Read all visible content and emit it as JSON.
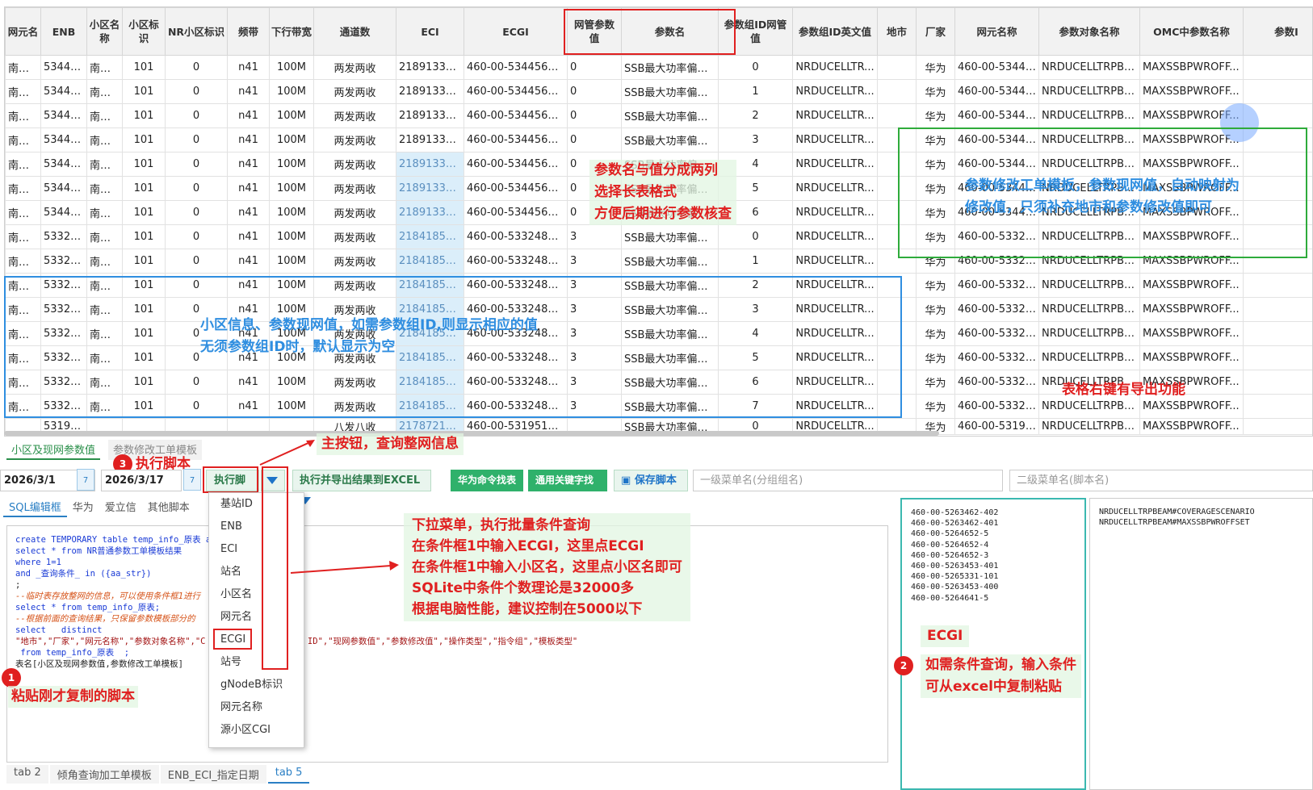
{
  "grid": {
    "columns": [
      "网元名",
      "ENB",
      "小区名称",
      "小区标识",
      "NR小区标识",
      "频带",
      "下行带宽",
      "通道数",
      "ECI",
      "ECGI",
      "网管参数值",
      "参数名",
      "参数组ID网管值",
      "参数组ID英文值",
      "地市",
      "厂家",
      "网元名称",
      "参数对象名称",
      "OMC中参数名称",
      "参数I"
    ],
    "rows": [
      [
        "南阳...",
        "53445...",
        "南阳...",
        "101",
        "0",
        "n41",
        "100M",
        "两发两收",
        "218913383...",
        "460-00-5344565-...",
        "0",
        "SSB最大功率偏置...",
        "0",
        "NRDUCELLTR...",
        "",
        "华为",
        "460-00-53445...",
        "NRDUCELLTRPBE...",
        "MAXSSBPWROFF...",
        ""
      ],
      [
        "南阳...",
        "53445...",
        "南阳...",
        "101",
        "0",
        "n41",
        "100M",
        "两发两收",
        "218913383...",
        "460-00-5344565-...",
        "0",
        "SSB最大功率偏置...",
        "1",
        "NRDUCELLTR...",
        "",
        "华为",
        "460-00-53445...",
        "NRDUCELLTRPBE...",
        "MAXSSBPWROFF...",
        ""
      ],
      [
        "南阳...",
        "53445...",
        "南阳...",
        "101",
        "0",
        "n41",
        "100M",
        "两发两收",
        "218913383...",
        "460-00-5344565-...",
        "0",
        "SSB最大功率偏置...",
        "2",
        "NRDUCELLTR...",
        "",
        "华为",
        "460-00-53445...",
        "NRDUCELLTRPBE...",
        "MAXSSBPWROFF...",
        ""
      ],
      [
        "南阳...",
        "53445...",
        "南阳...",
        "101",
        "0",
        "n41",
        "100M",
        "两发两收",
        "218913383...",
        "460-00-5344565-...",
        "0",
        "SSB最大功率偏置...",
        "3",
        "NRDUCELLTR...",
        "",
        "华为",
        "460-00-53445...",
        "NRDUCELLTRPBE...",
        "MAXSSBPWROFF...",
        ""
      ],
      [
        "南阳...",
        "53445...",
        "南阳...",
        "101",
        "0",
        "n41",
        "100M",
        "两发两收",
        "21891338...",
        "460-00-5344565-...",
        "0",
        "SSB最大功率偏置...",
        "4",
        "NRDUCELLTR...",
        "",
        "华为",
        "460-00-53445...",
        "NRDUCELLTRPBE...",
        "MAXSSBPWROFF...",
        ""
      ],
      [
        "南阳...",
        "53445...",
        "南阳...",
        "101",
        "0",
        "n41",
        "100M",
        "两发两收",
        "21891338...",
        "460-00-5344565-...",
        "0",
        "SSB最大功率偏置...",
        "5",
        "NRDUCELLTR...",
        "",
        "华为",
        "460-00-53445...",
        "NRDUCELLTRPBE...",
        "MAXSSBPWROFF...",
        ""
      ],
      [
        "南阳...",
        "53445...",
        "南阳...",
        "101",
        "0",
        "n41",
        "100M",
        "两发两收",
        "21891338...",
        "460-00-5344565-...",
        "0",
        "SSB最大功率偏置...",
        "6",
        "NRDUCELLTR...",
        "",
        "华为",
        "460-00-53445...",
        "NRDUCELLTRPBE...",
        "MAXSSBPWROFF...",
        ""
      ],
      [
        "南阳...",
        "53324...",
        "南阳...",
        "101",
        "0",
        "n41",
        "100M",
        "两发两收",
        "21841858...",
        "460-00-5332485-...",
        "3",
        "SSB最大功率偏置...",
        "0",
        "NRDUCELLTR...",
        "",
        "华为",
        "460-00-53324...",
        "NRDUCELLTRPBE...",
        "MAXSSBPWROFF...",
        ""
      ],
      [
        "南阳...",
        "53324...",
        "南阳...",
        "101",
        "0",
        "n41",
        "100M",
        "两发两收",
        "21841858...",
        "460-00-5332485-...",
        "3",
        "SSB最大功率偏置...",
        "1",
        "NRDUCELLTR...",
        "",
        "华为",
        "460-00-53324...",
        "NRDUCELLTRPBE...",
        "MAXSSBPWROFF...",
        ""
      ],
      [
        "南阳...",
        "53324...",
        "南阳...",
        "101",
        "0",
        "n41",
        "100M",
        "两发两收",
        "21841858...",
        "460-00-5332485-...",
        "3",
        "SSB最大功率偏置...",
        "2",
        "NRDUCELLTR...",
        "",
        "华为",
        "460-00-53324...",
        "NRDUCELLTRPBE...",
        "MAXSSBPWROFF...",
        ""
      ],
      [
        "南阳...",
        "53324...",
        "南阳...",
        "101",
        "0",
        "n41",
        "100M",
        "两发两收",
        "21841858...",
        "460-00-5332485-...",
        "3",
        "SSB最大功率偏置...",
        "3",
        "NRDUCELLTR...",
        "",
        "华为",
        "460-00-53324...",
        "NRDUCELLTRPBE...",
        "MAXSSBPWROFF...",
        ""
      ],
      [
        "南阳...",
        "53324...",
        "南阳...",
        "101",
        "0",
        "n41",
        "100M",
        "两发两收",
        "21841858...",
        "460-00-5332485-...",
        "3",
        "SSB最大功率偏置...",
        "4",
        "NRDUCELLTR...",
        "",
        "华为",
        "460-00-53324...",
        "NRDUCELLTRPBE...",
        "MAXSSBPWROFF...",
        ""
      ],
      [
        "南阳...",
        "53324...",
        "南阳...",
        "101",
        "0",
        "n41",
        "100M",
        "两发两收",
        "21841858...",
        "460-00-5332485-...",
        "3",
        "SSB最大功率偏置...",
        "5",
        "NRDUCELLTR...",
        "",
        "华为",
        "460-00-53324...",
        "NRDUCELLTRPBE...",
        "MAXSSBPWROFF...",
        ""
      ],
      [
        "南阳...",
        "53324...",
        "南阳...",
        "101",
        "0",
        "n41",
        "100M",
        "两发两收",
        "21841858...",
        "460-00-5332485-...",
        "3",
        "SSB最大功率偏置...",
        "6",
        "NRDUCELLTR...",
        "",
        "华为",
        "460-00-53324...",
        "NRDUCELLTRPBE...",
        "MAXSSBPWROFF...",
        ""
      ],
      [
        "南阳...",
        "53324...",
        "南阳...",
        "101",
        "0",
        "n41",
        "100M",
        "两发两收",
        "21841858...",
        "460-00-5332485-...",
        "3",
        "SSB最大功率偏置...",
        "7",
        "NRDUCELLTR...",
        "",
        "华为",
        "460-00-53324...",
        "NRDUCELLTRPBE...",
        "MAXSSBPWROFF...",
        ""
      ],
      [
        "",
        "53195...",
        "",
        "",
        "",
        "",
        "",
        "八发八收",
        "21787211...",
        "460-00-5319512-0...",
        "",
        "SSB最大功率偏置...",
        "0",
        "NRDUCELLTR...",
        "",
        "华为",
        "460-00-53195...",
        "NRDUCELLTRPBE...",
        "MAXSSBPWROFF...",
        ""
      ]
    ]
  },
  "bottom_tabs": [
    "小区及现网参数值",
    "参数修改工单模板"
  ],
  "toolbar": {
    "date_start": "2026/3/1",
    "date_end": "2026/3/17",
    "calendar_day": "7",
    "run_label": "执行脚本",
    "run_export_label": "执行并导出结果到EXCEL",
    "huawei_cmd_label": "华为命令找表",
    "keyword_label": "通用关键字找表",
    "save_label": "保存脚本",
    "menu1_placeholder": "一级菜单名(分组组名)",
    "menu2_placeholder": "二级菜单名(脚本名)"
  },
  "editor_tabs": [
    "SQL编辑框",
    "华为",
    "爱立信",
    "其他脚本",
    "",
    "据"
  ],
  "editor_lines": [
    {
      "t": "create TEMPORARY table temp_info_原表 as",
      "c": "kw"
    },
    {
      "t": "select * from NR普通参数工单模板结果",
      "c": "kw"
    },
    {
      "t": "where 1=1",
      "c": "kw"
    },
    {
      "t": "and _查询条件_ in ({aa_str})",
      "c": "kw"
    },
    {
      "t": ";",
      "c": ""
    },
    {
      "t": "--临时表存放整网的信息，可以使用条件框1进行",
      "c": "cm"
    },
    {
      "t": "select * from temp_info_原表;",
      "c": "kw"
    },
    {
      "t": "--根据前面的查询结果，只保留参数模板部分的",
      "c": "cm"
    },
    {
      "t": "select   distinct",
      "c": "kw"
    },
    {
      "t": "\"地市\",\"厂家\",\"网元名称\",\"参数对象名称\",\"C                    ID\",\"现网参数值\",\"参数修改值\",\"操作类型\",\"指令组\",\"模板类型\"",
      "c": "str"
    },
    {
      "t": " from temp_info_原表  ;",
      "c": "kw"
    },
    {
      "t": "表名[小区及现网参数值,参数修改工单模板]",
      "c": ""
    }
  ],
  "bottom_tabs2": [
    "tab 2",
    "倾角查询加工单模板",
    "ENB_ECI_指定日期",
    "tab 5"
  ],
  "dropdown_items": [
    "基站ID",
    "ENB",
    "ECI",
    "站名",
    "小区名",
    "网元名",
    "ECGI",
    "站号",
    "gNodeB标识",
    "网元名称",
    "源小区CGI"
  ],
  "condition_box1": [
    "460-00-5263462-402",
    "460-00-5263462-401",
    "460-00-5264652-5",
    "460-00-5264652-4",
    "460-00-5264652-3",
    "460-00-5263453-401",
    "460-00-5265331-101",
    "460-00-5263453-400",
    "460-00-5264641-5"
  ],
  "condition_box2": [
    "NRDUCELLTRPBEAM#COVERAGESCENARIO",
    "NRDUCELLTRPBEAM#MAXSSBPWROFFSET"
  ],
  "annotations": {
    "param_split": [
      "参数名与值分成两列",
      "选择长表格式",
      "方便后期进行参数核查"
    ],
    "modify_template": [
      "参数修改工单模板，参数现网值，自动映射为",
      "修改值，只须补充地市和参数修改值即可"
    ],
    "cell_info": [
      "小区信息、参数现网值，如需参数组ID,则显示相应的值",
      "无须参数组ID时，默认显示为空"
    ],
    "export": "表格右键有导出功能",
    "main_button": "主按钮，查询整网信息",
    "run_script": "执行脚本",
    "paste_script": "粘贴刚才复制的脚本",
    "dropdown_note": [
      "下拉菜单，执行批量条件查询",
      "在条件框1中输入ECGI，这里点ECGI",
      "在条件框1中输入小区名，这里点小区名即可",
      "SQLite中条件个数理论是32000多",
      "根据电脑性能，建议控制在5000以下"
    ],
    "ecgi_label": "ECGI",
    "condition_note": [
      "如需条件查询，输入条件",
      "可从excel中复制粘贴"
    ],
    "step1": "1",
    "step2": "2",
    "step3": "3"
  },
  "colors": {
    "red": "#e02020",
    "green": "#2eab3b",
    "blue": "#2f8ee0",
    "accent_green": "#2fb16b"
  }
}
